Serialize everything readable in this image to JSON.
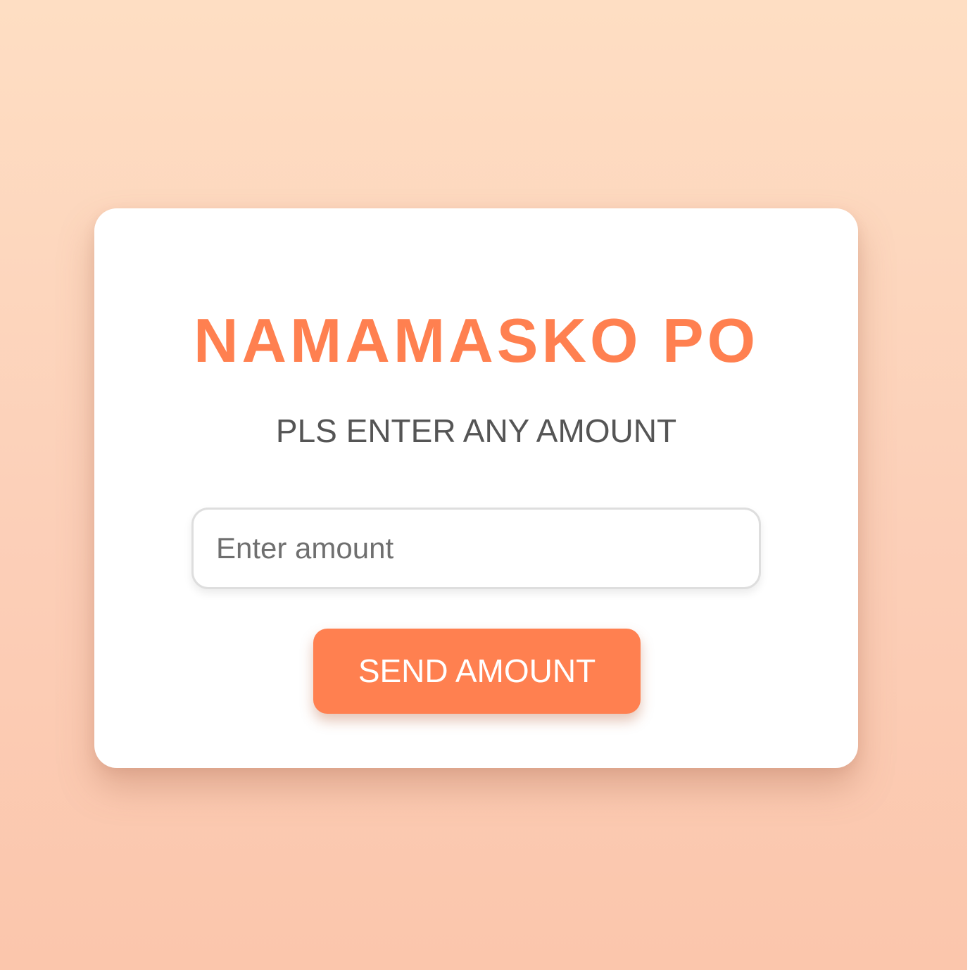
{
  "card": {
    "title": "NAMAMASKO PO",
    "subtitle": "PLS ENTER ANY AMOUNT",
    "amount_input": {
      "value": "",
      "placeholder": "Enter amount"
    },
    "send_button_label": "SEND AMOUNT"
  },
  "colors": {
    "accent": "#ff8050",
    "background_top": "#fedec3",
    "background_bottom": "#fbc6ac",
    "card": "#ffffff",
    "subtitle_text": "#555555",
    "placeholder_text": "#6f6f6f"
  }
}
